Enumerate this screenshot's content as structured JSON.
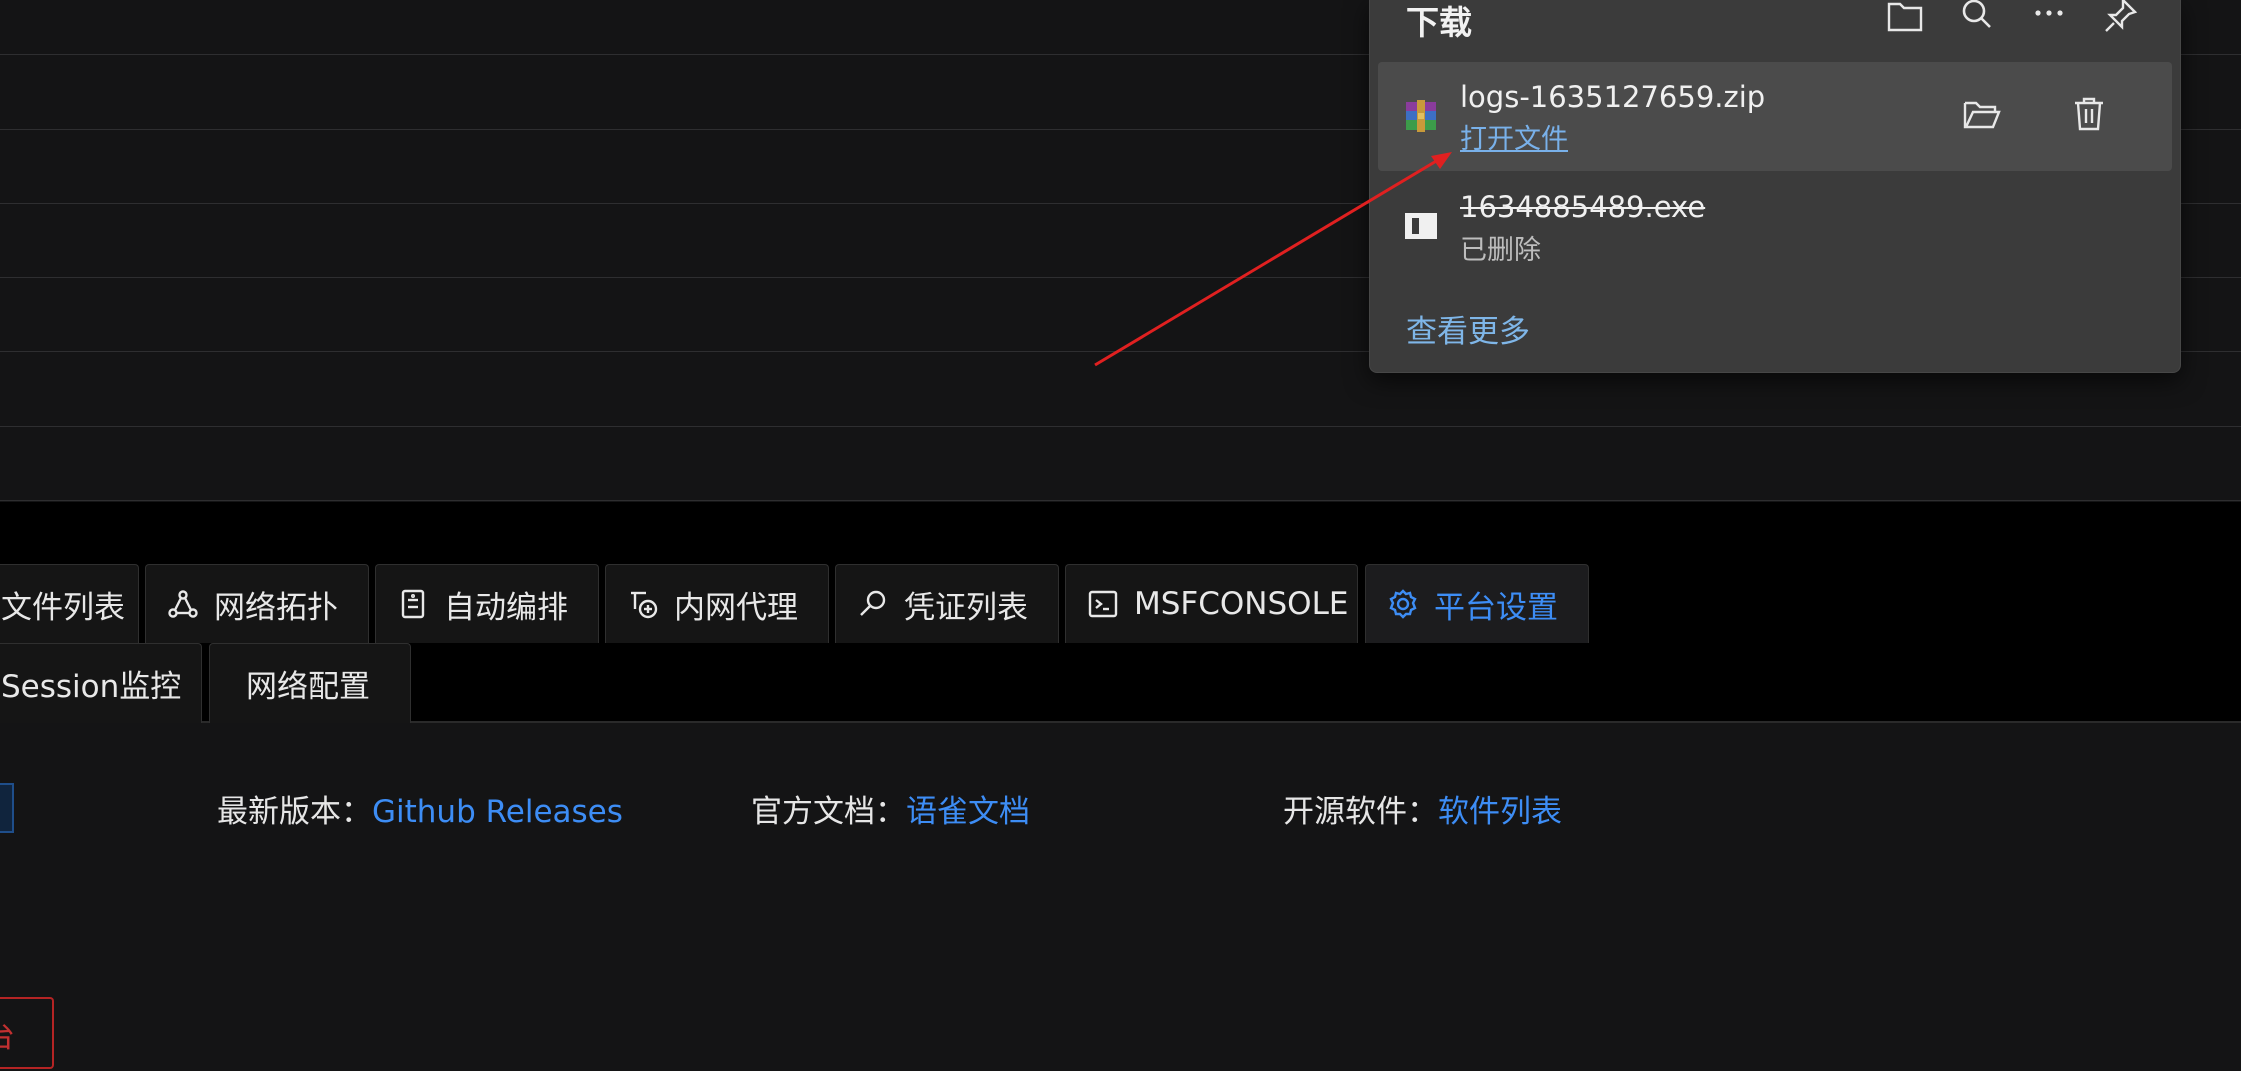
{
  "tabs_row1": [
    {
      "label": "文件列表",
      "icon": "file-list-icon",
      "active": false
    },
    {
      "label": "网络拓扑",
      "icon": "network-topology-icon",
      "active": false
    },
    {
      "label": "自动编排",
      "icon": "auto-arrange-icon",
      "active": false
    },
    {
      "label": "内网代理",
      "icon": "proxy-icon",
      "active": false
    },
    {
      "label": "凭证列表",
      "icon": "credential-icon",
      "active": false
    },
    {
      "label": "MSFCONSOLE",
      "icon": "terminal-icon",
      "active": false
    },
    {
      "label": "平台设置",
      "icon": "gear-icon",
      "active": true
    }
  ],
  "tabs_row2": [
    {
      "label": "Session监控"
    },
    {
      "label": "网络配置"
    }
  ],
  "info": {
    "latest_label": "最新版本：",
    "latest_link": "Github Releases",
    "docs_label": "官方文档：",
    "docs_link": "语雀文档",
    "oss_label": "开源软件：",
    "oss_link": "软件列表"
  },
  "red_button_text": "台",
  "download_panel": {
    "title": "下载",
    "items": [
      {
        "file_name": "logs-1635127659.zip",
        "action": "打开文件",
        "type": "zip-archive-icon"
      },
      {
        "file_name": "1634885489.exe",
        "status": "已删除",
        "type": "exe-file-icon"
      }
    ],
    "see_more": "查看更多"
  },
  "colors": {
    "accent": "#3d8df5",
    "annotation_arrow": "#e02020",
    "danger": "#b52424"
  }
}
